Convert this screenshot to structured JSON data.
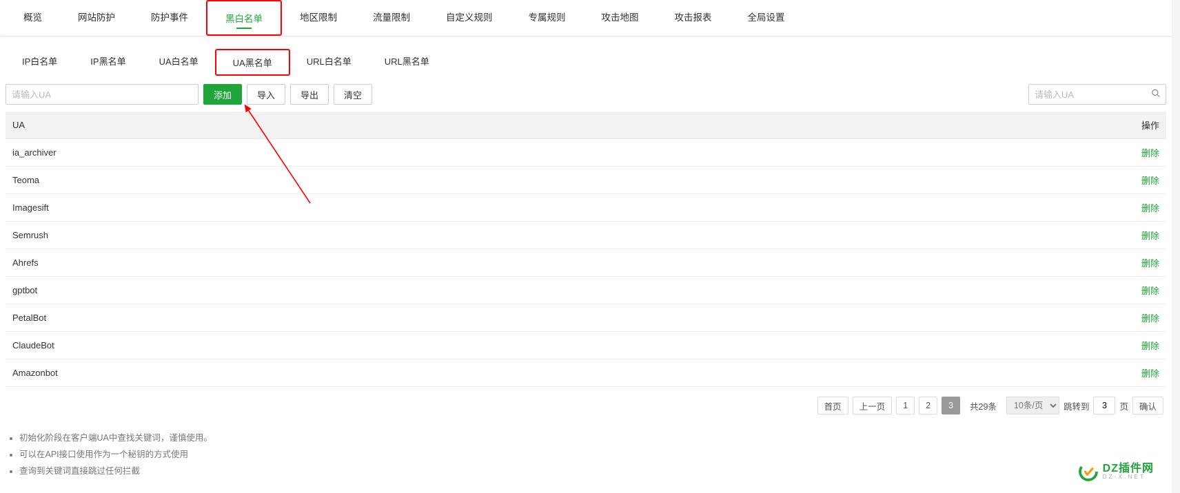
{
  "topnav": {
    "items": [
      {
        "label": "概览"
      },
      {
        "label": "网站防护"
      },
      {
        "label": "防护事件"
      },
      {
        "label": "黑白名单",
        "active": true
      },
      {
        "label": "地区限制"
      },
      {
        "label": "流量限制"
      },
      {
        "label": "自定义规则"
      },
      {
        "label": "专属规则"
      },
      {
        "label": "攻击地图"
      },
      {
        "label": "攻击报表"
      },
      {
        "label": "全局设置"
      }
    ]
  },
  "subnav": {
    "items": [
      {
        "label": "IP白名单"
      },
      {
        "label": "IP黑名单"
      },
      {
        "label": "UA白名单"
      },
      {
        "label": "UA黑名单",
        "active": true
      },
      {
        "label": "URL白名单"
      },
      {
        "label": "URL黑名单"
      }
    ]
  },
  "toolbar": {
    "input_placeholder": "请输入UA",
    "add_label": "添加",
    "import_label": "导入",
    "export_label": "导出",
    "clear_label": "清空",
    "search_placeholder": "请输入UA"
  },
  "table": {
    "header_ua": "UA",
    "header_op": "操作",
    "rows": [
      {
        "ua": "ia_archiver"
      },
      {
        "ua": "Teoma"
      },
      {
        "ua": "Imagesift"
      },
      {
        "ua": "Semrush"
      },
      {
        "ua": "Ahrefs"
      },
      {
        "ua": "gptbot"
      },
      {
        "ua": "PetalBot"
      },
      {
        "ua": "ClaudeBot"
      },
      {
        "ua": "Amazonbot"
      }
    ],
    "delete_label": "删除"
  },
  "pagination": {
    "first": "首页",
    "prev": "上一页",
    "pages": [
      "1",
      "2",
      "3"
    ],
    "active_page": "3",
    "total": "共29条",
    "per_page": "10条/页",
    "jump_label": "跳转到",
    "jump_value": "3",
    "page_suffix": "页",
    "confirm": "确认"
  },
  "tips": [
    "初始化阶段在客户端UA中查找关键词，谨慎使用。",
    "可以在API接口使用作为一个秘钥的方式使用",
    "查询到关键词直接跳过任何拦截"
  ],
  "watermark": {
    "title": "DZ插件网",
    "sub": "D Z - X . N E T"
  }
}
